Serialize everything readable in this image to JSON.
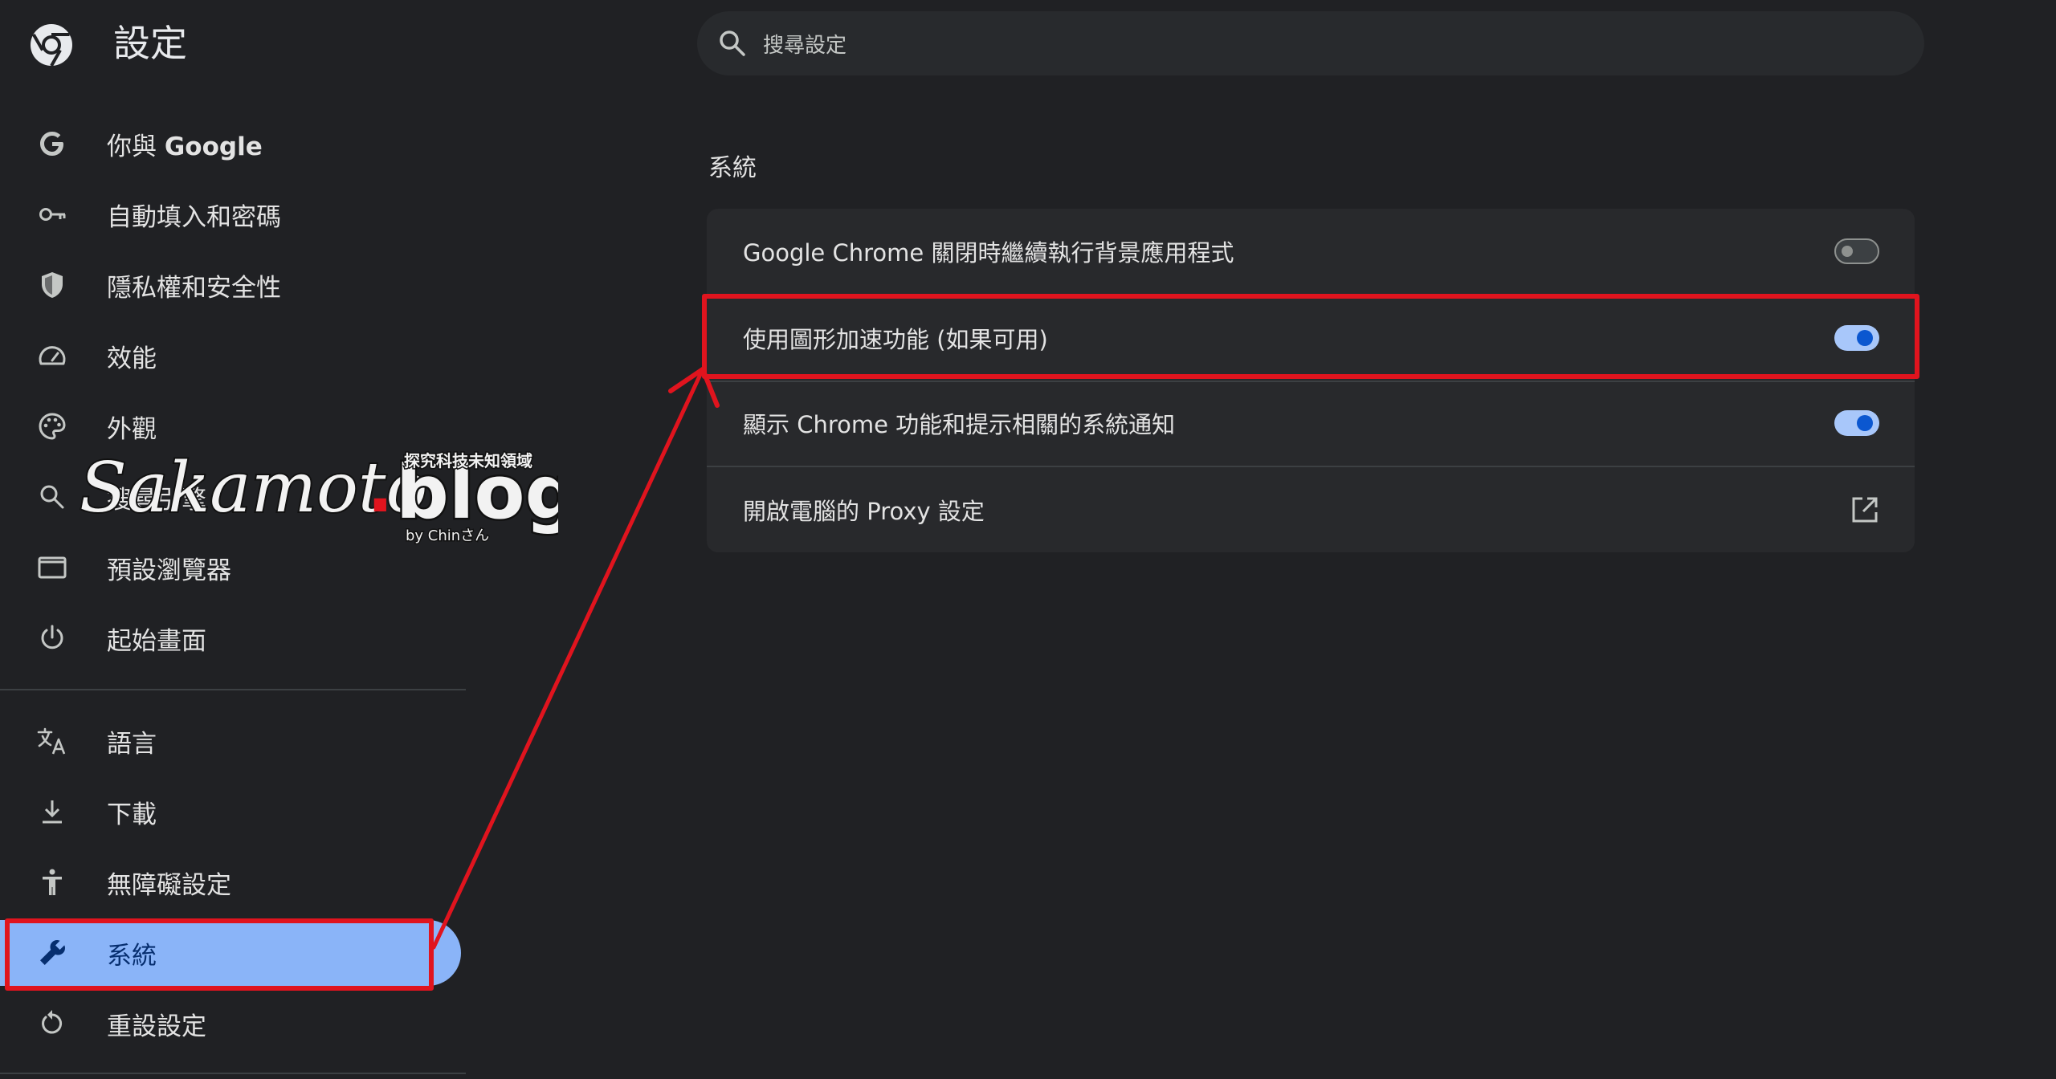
{
  "header": {
    "title": "設定",
    "logo_icon": "chrome-logo-icon"
  },
  "search": {
    "placeholder": "搜尋設定",
    "icon": "search-icon"
  },
  "sidebar": {
    "items": [
      {
        "label_prefix": "你與 ",
        "label_strong": "Google",
        "icon": "google-g-icon"
      },
      {
        "label": "自動填入和密碼",
        "icon": "key-icon"
      },
      {
        "label": "隱私權和安全性",
        "icon": "shield-icon"
      },
      {
        "label": "效能",
        "icon": "speedometer-icon"
      },
      {
        "label": "外觀",
        "icon": "palette-icon"
      },
      {
        "label": "搜尋引擎",
        "icon": "search-icon"
      },
      {
        "label": "預設瀏覽器",
        "icon": "browser-window-icon"
      },
      {
        "label": "起始畫面",
        "icon": "power-icon"
      },
      {
        "label": "語言",
        "icon": "translate-icon"
      },
      {
        "label": "下載",
        "icon": "download-icon"
      },
      {
        "label": "無障礙設定",
        "icon": "accessibility-icon"
      },
      {
        "label": "系統",
        "icon": "wrench-icon",
        "active": true
      },
      {
        "label": "重設設定",
        "icon": "reset-icon"
      }
    ]
  },
  "watermark": {
    "brand_main": "Sakamoto",
    "brand_dot": ".",
    "brand_tld": "blog",
    "tagline": "探究科技未知領域",
    "byline": "by Chinさん"
  },
  "section": {
    "title": "系統",
    "rows": [
      {
        "label": "Google Chrome 關閉時繼續執行背景應用程式",
        "control": "toggle",
        "state": "off"
      },
      {
        "label": "使用圖形加速功能 (如果可用)",
        "control": "toggle",
        "state": "on"
      },
      {
        "label": "顯示 Chrome 功能和提示相關的系統通知",
        "control": "toggle",
        "state": "on"
      },
      {
        "label": "開啟電腦的 Proxy 設定",
        "control": "external-link"
      }
    ]
  },
  "colors": {
    "background": "#202124",
    "card": "#28292c",
    "accent": "#8ab4f8",
    "toggle_on_track": "#a8c7fa",
    "toggle_on_knob": "#0b57d0",
    "annotation_red": "#e0141e"
  }
}
